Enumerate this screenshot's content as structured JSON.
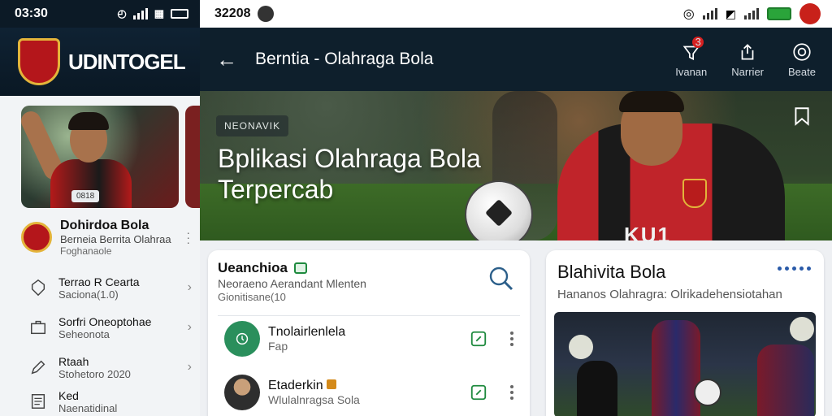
{
  "left": {
    "status_time": "03:30",
    "brand": "UDINTOGEL",
    "card_tag": "0818",
    "featured": {
      "title": "Dohirdoa Bola",
      "subtitle": "Berneia Berrita Olahraa",
      "meta": "Foghanaole"
    },
    "rows": [
      {
        "title": "Terrao R Cearta",
        "sub": "Saciona(1.0)",
        "icon": "shield-icon"
      },
      {
        "title": "Sorfri Oneoptohae",
        "sub": "Seheonota",
        "icon": "briefcase-icon"
      },
      {
        "title": "Rtaah",
        "sub": "Stohetoro 2020",
        "icon": "pencil-icon"
      },
      {
        "title": "Ked",
        "sub": "Naenatidinal",
        "icon": "document-icon"
      }
    ]
  },
  "right": {
    "status_time": "32208",
    "appbar": {
      "title": "Berntia - Olahraga Bola",
      "actions": [
        {
          "label": "Ivanan",
          "icon": "bell-icon",
          "badge": "3"
        },
        {
          "label": "Narrier",
          "icon": "share-icon"
        },
        {
          "label": "Beate",
          "icon": "settings-icon"
        }
      ]
    },
    "hero": {
      "chip": "NEONAVIK",
      "title": "Bplikasi Olahraga Bola Terpercab",
      "jersey_number": "KU1"
    },
    "card1": {
      "title": "Ueanchioa",
      "line1": "Neoraeno Aerandant Mlenten",
      "line2": "Gionitisane(10",
      "items": [
        {
          "title": "Tnolairlenlela",
          "sub": "Fap"
        },
        {
          "title": "Etaderkin",
          "sub": "Wlulalnragsa Sola"
        }
      ]
    },
    "card2": {
      "title": "Blahivita Bola",
      "subtitle": "Hananos Olahragra: Olrikadehensiotahan"
    }
  },
  "colors": {
    "appbar": "#0e1f2c",
    "accent_red": "#c0242a",
    "accent_green": "#1e8a3e",
    "gold": "#e4b43a"
  }
}
